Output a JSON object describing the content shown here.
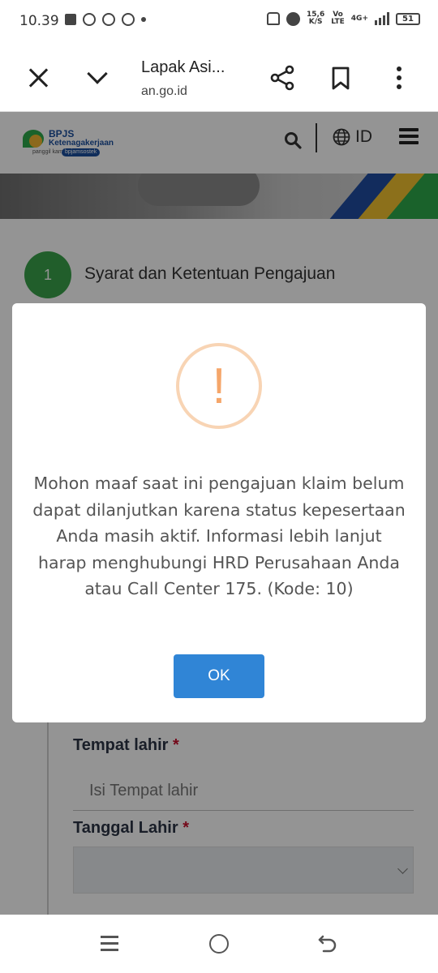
{
  "status_bar": {
    "time": "10.39",
    "net_speed_top": "15,6",
    "net_speed_unit": "K/S",
    "volte_top": "Vo",
    "volte_bottom": "LTE",
    "network": "4G+",
    "battery": "51"
  },
  "browser": {
    "title": "Lapak Asi...",
    "url": "an.go.id"
  },
  "site_header": {
    "logo_line1": "BPJS",
    "logo_line2": "Ketenagakerjaan",
    "logo_tagline": "panggil kami",
    "logo_pill": "bpjamsostek",
    "language": "ID"
  },
  "form": {
    "step_number": "1",
    "step_title": "Syarat dan Ketentuan Pengajuan",
    "birthplace_label": "Tempat lahir",
    "birthplace_placeholder": "Isi Tempat lahir",
    "birthdate_label": "Tanggal Lahir",
    "required_mark": "*"
  },
  "modal": {
    "icon": "warning-exclamation-icon",
    "icon_symbol": "!",
    "message": "Mohon maaf saat ini pengajuan klaim belum dapat dilanjutkan karena status kepesertaan Anda masih aktif. Informasi lebih lanjut harap menghubungi HRD Perusahaan Anda atau Call Center 175. (Kode: 10)",
    "ok_label": "OK"
  },
  "colors": {
    "step_green": "#3aa24a",
    "ok_blue": "#3085d6",
    "warning_orange": "#f5a66a",
    "required_red": "#c8102e"
  }
}
